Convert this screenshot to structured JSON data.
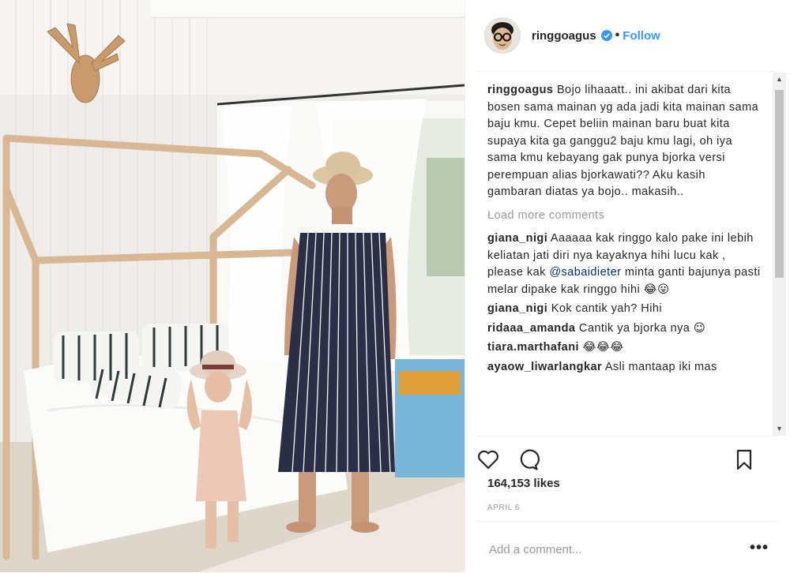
{
  "post": {
    "username": "ringgoagus",
    "follow_label": "Follow",
    "separator": "•",
    "likes": "164,153 likes",
    "date": "APRIL 6",
    "add_comment_placeholder": "Add a comment...",
    "more_options_glyph": "•••"
  },
  "caption": {
    "user": "ringgoagus",
    "text": "Bojo lihaaatt.. ini akibat dari kita bosen sama mainan yg ada jadi kita mainan sama baju kmu. Cepet beliin mainan baru buat kita supaya kita ga ganggu2 baju kmu lagi, oh iya sama kmu kebayang gak punya bjorka versi perempuan alias bjorkawati?? Aku kasih gambaran diatas ya bojo.. makasih.."
  },
  "load_more": "Load more comments",
  "comments": [
    {
      "user": "giana_nigi",
      "text_before": "Aaaaaa kak ringgo kalo pake ini lebih keliatan jati diri nya kayaknya hihi lucu kak , please kak ",
      "mention": "@sabaidieter",
      "text_after": " minta ganti bajunya pasti melar dipake kak ringgo hihi 😂😛"
    },
    {
      "user": "giana_nigi",
      "text_before": "Kok cantik yah? Hihi",
      "mention": "",
      "text_after": ""
    },
    {
      "user": "ridaaa_amanda",
      "text_before": "Cantik ya bjorka nya 😉",
      "mention": "",
      "text_after": ""
    },
    {
      "user": "tiara.marthafani",
      "text_before": "😂😂😂",
      "mention": "",
      "text_after": ""
    },
    {
      "user": "ayaow_liwarlangkar",
      "text_before": "Asli mantaap iki mas",
      "mention": "",
      "text_after": ""
    }
  ],
  "colors": {
    "link_blue": "#3897f0",
    "mention_blue": "#003569",
    "muted": "#999999",
    "text": "#262626"
  },
  "icons": [
    "verified-badge-icon",
    "heart-icon",
    "comment-icon",
    "bookmark-icon",
    "more-options-icon",
    "scroll-up-arrow-icon",
    "scroll-down-arrow-icon"
  ]
}
